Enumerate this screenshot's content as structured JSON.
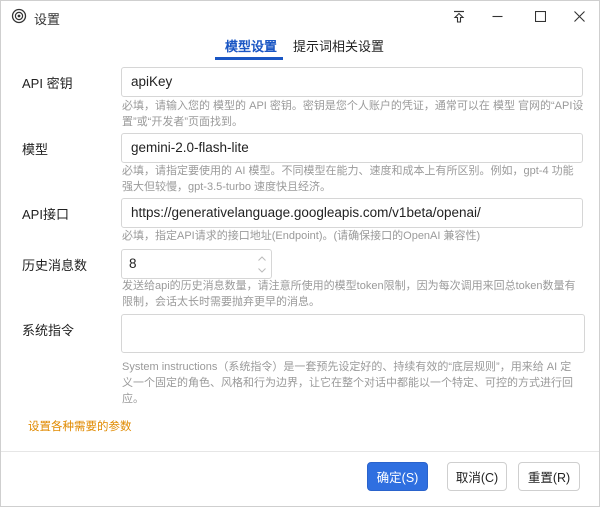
{
  "window": {
    "title": "设置"
  },
  "tabs": [
    {
      "label": "模型设置",
      "active": true
    },
    {
      "label": "提示词相关设置",
      "active": false
    }
  ],
  "form": {
    "api_key": {
      "label": "API 密钥",
      "value": "apiKey",
      "help_line1": "必填，请输入您的 模型的 API 密钥。密钥是您个人账户的凭证，通常可以在 模型 官网的“API设",
      "help_line2": "置”或“开发者”页面找到。"
    },
    "model": {
      "label": "模型",
      "value": "gemini-2.0-flash-lite",
      "help_line1": "必填，请指定要使用的 AI 模型。不同模型在能力、速度和成本上有所区别。例如，gpt-4 功能",
      "help_line2": "强大但较慢，gpt-3.5-turbo 速度快且经济。"
    },
    "api_endpoint": {
      "label": "API接口",
      "value": "https://generativelanguage.googleapis.com/v1beta/openai/",
      "help_line1": "必填，指定API请求的接口地址(Endpoint)。(请确保接口的OpenAI 兼容性)"
    },
    "history_count": {
      "label": "历史消息数",
      "value": "8",
      "help_line1": "发送给api的历史消息数量，请注意所使用的模型token限制，因为每次调用来回总token数量有",
      "help_line2": "限制，会话太长时需要抛弃更早的消息。"
    },
    "system_prompt": {
      "label": "系统指令",
      "value": "",
      "help_line1": "System instructions（系统指令）是一套预先设定好的、持续有效的“底层规则”，用来给 AI 定",
      "help_line2": "义一个固定的角色、风格和行为边界，让它在整个对话中都能以一个特定、可控的方式进行回",
      "help_line3": "应。"
    }
  },
  "hint": "设置各种需要的参数",
  "buttons": {
    "ok": "确定(S)",
    "cancel": "取消(C)",
    "reset": "重置(R)"
  },
  "colors": {
    "accent": "#2f6fe0",
    "tab_active": "#1a56c4",
    "hint": "#e08a00",
    "help_text": "#9a9a9a"
  }
}
